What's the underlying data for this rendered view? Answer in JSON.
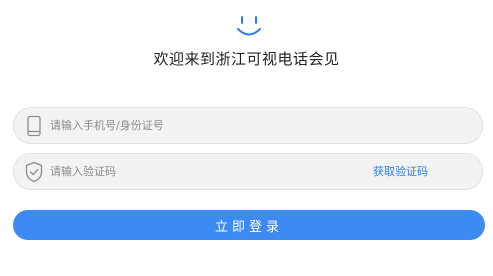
{
  "header": {
    "logo_icon": "smile-icon",
    "title": "欢迎来到浙江可视电话会见"
  },
  "form": {
    "phone": {
      "icon": "phone-icon",
      "placeholder": "请输入手机号/身份证号",
      "value": ""
    },
    "code": {
      "icon": "shield-check-icon",
      "placeholder": "请输入验证码",
      "value": "",
      "get_code_label": "获取验证码"
    },
    "login_label": "立即登录"
  },
  "colors": {
    "accent": "#3d8bf2",
    "link": "#2f7fe6",
    "field_background": "#f3f3f3"
  }
}
